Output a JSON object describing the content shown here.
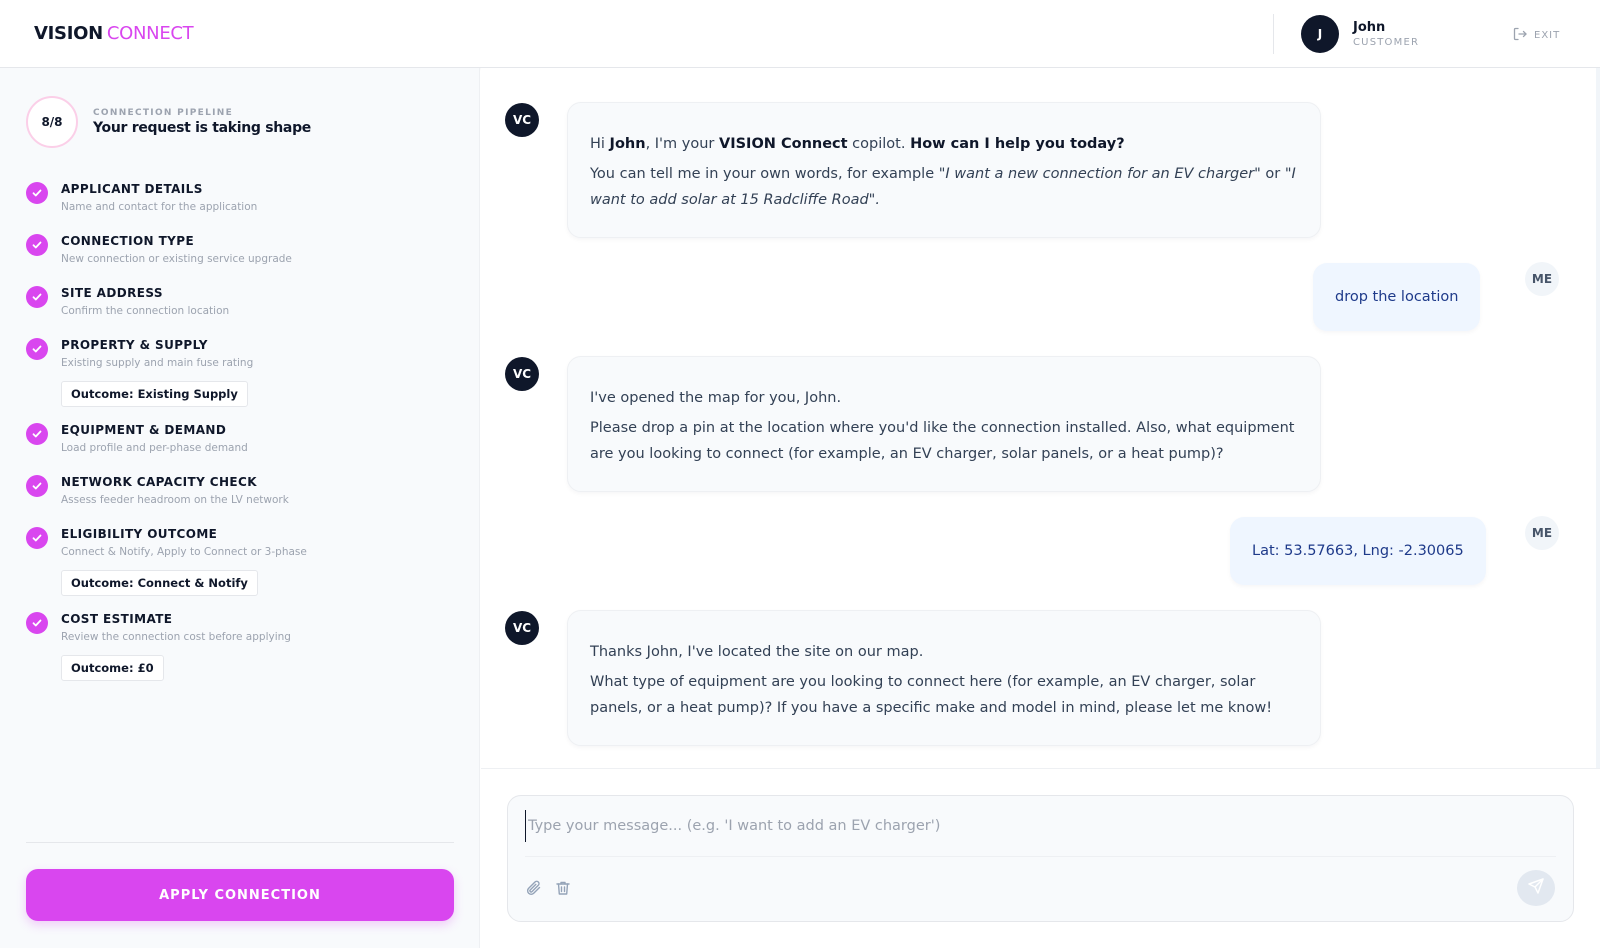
{
  "brand": {
    "part1": "VISION",
    "part2": "CONNECT"
  },
  "user": {
    "initial": "J",
    "name": "John",
    "role": "CUSTOMER",
    "exit_label": "EXIT"
  },
  "pipeline": {
    "progress": "8/8",
    "label": "CONNECTION PIPELINE",
    "title": "Your request is taking shape",
    "steps": [
      {
        "title": "APPLICANT DETAILS",
        "desc": "Name and contact for the application",
        "status": "complete"
      },
      {
        "title": "CONNECTION TYPE",
        "desc": "New connection or existing service upgrade",
        "status": "complete"
      },
      {
        "title": "SITE ADDRESS",
        "desc": "Confirm the connection location",
        "status": "complete"
      },
      {
        "title": "PROPERTY & SUPPLY",
        "desc": "Existing supply and main fuse rating",
        "outcome": "Outcome: Existing Supply",
        "status": "complete"
      },
      {
        "title": "EQUIPMENT & DEMAND",
        "desc": "Load profile and per-phase demand",
        "status": "complete"
      },
      {
        "title": "NETWORK CAPACITY CHECK",
        "desc": "Assess feeder headroom on the LV network",
        "status": "complete"
      },
      {
        "title": "ELIGIBILITY OUTCOME",
        "desc": "Connect & Notify, Apply to Connect or 3-phase",
        "outcome": "Outcome: Connect & Notify",
        "status": "complete"
      },
      {
        "title": "COST ESTIMATE",
        "desc": "Review the connection cost before applying",
        "outcome": "Outcome: £0",
        "status": "complete"
      }
    ],
    "apply_label": "APPLY CONNECTION"
  },
  "chat": {
    "bot_initials": "VC",
    "me_label": "ME",
    "m1": {
      "hi": "Hi ",
      "name": "John",
      "mid": ", I'm your ",
      "brand": "VISION Connect",
      "copilot": " copilot. ",
      "help": "How can I help you today?",
      "l2a": "You can tell me in your own words, for example ",
      "ex1": "\"I want a new connection for an EV charger\"",
      "or": " or ",
      "ex2": "\"I want to add solar at 15 Radcliffe Road\"."
    },
    "u1": "drop the location",
    "m2": {
      "l1": "I've opened the map for you, John.",
      "l2": "Please drop a pin at the location where you'd like the connection installed. Also, what equipment are you looking to connect (for example, an EV charger, solar panels, or a heat pump)?"
    },
    "u2": "Lat: 53.57663, Lng: -2.30065",
    "m3": {
      "l1": "Thanks John, I've located the site on our map.",
      "l2": "What type of equipment are you looking to connect here (for example, an EV charger, solar panels, or a heat pump)? If you have a specific make and model in mind, please let me know!"
    }
  },
  "composer": {
    "placeholder": "Type your message... (e.g. 'I want to add an EV charger')",
    "value": ""
  },
  "colors": {
    "accent": "#d946ef",
    "navy": "#0f172a",
    "user_bubble": "#eff6ff"
  }
}
